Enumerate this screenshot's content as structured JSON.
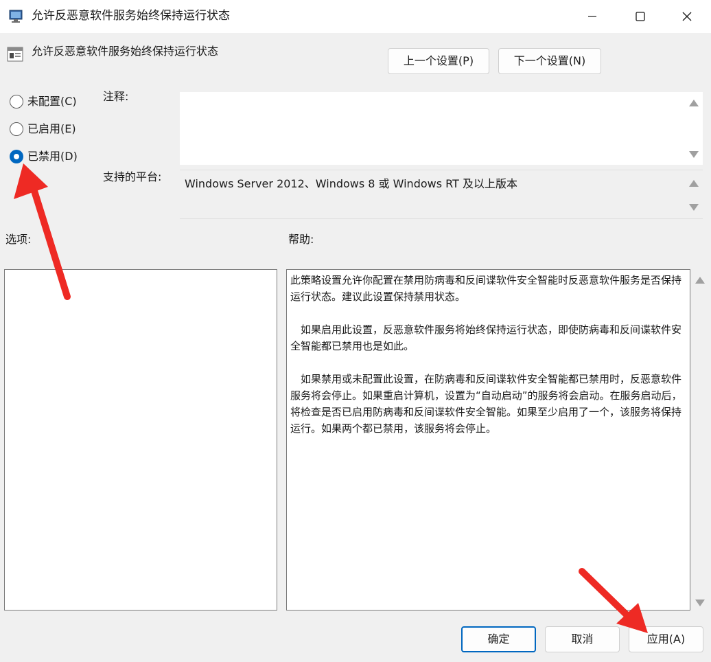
{
  "window": {
    "title": "允许反恶意软件服务始终保持运行状态"
  },
  "header": {
    "policy_name": "允许反恶意软件服务始终保持运行状态",
    "prev_label": "上一个设置(P)",
    "next_label": "下一个设置(N)"
  },
  "state_options": [
    {
      "label": "未配置(C)",
      "checked": false
    },
    {
      "label": "已启用(E)",
      "checked": false
    },
    {
      "label": "已禁用(D)",
      "checked": true
    }
  ],
  "comment": {
    "label": "注释:",
    "value": ""
  },
  "platform": {
    "label": "支持的平台:",
    "value": "Windows Server 2012、Windows 8 或 Windows RT 及以上版本"
  },
  "options": {
    "label": "选项:"
  },
  "help": {
    "label": "帮助:",
    "paragraphs": [
      "此策略设置允许你配置在禁用防病毒和反间谍软件安全智能时反恶意软件服务是否保持运行状态。建议此设置保持禁用状态。",
      "如果启用此设置，反恶意软件服务将始终保持运行状态，即使防病毒和反间谍软件安全智能都已禁用也是如此。",
      "如果禁用或未配置此设置，在防病毒和反间谍软件安全智能都已禁用时，反恶意软件服务将会停止。如果重启计算机，设置为“自动启动”的服务将会启动。在服务启动后，将检查是否已启用防病毒和反间谍软件安全智能。如果至少启用了一个，该服务将保持运行。如果两个都已禁用，该服务将会停止。"
    ]
  },
  "footer": {
    "ok_label": "确定",
    "cancel_label": "取消",
    "apply_label": "应用(A)"
  },
  "colors": {
    "accent": "#0067c0",
    "annotation": "#ee2a24"
  }
}
